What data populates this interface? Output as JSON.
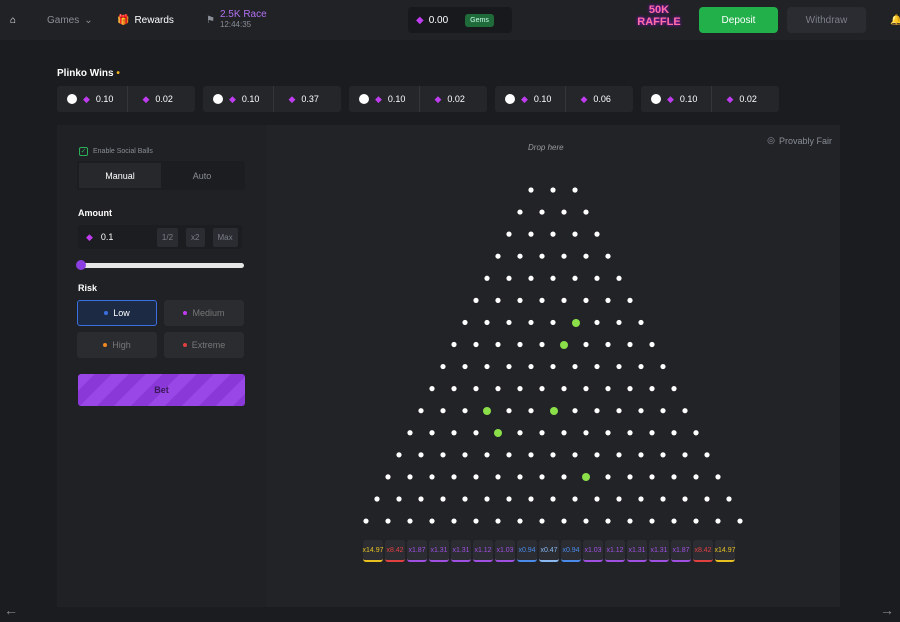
{
  "nav": {
    "games": "Games",
    "rewards": "Rewards",
    "race_title": "2.5K Race",
    "race_timer": "12:44:35",
    "balance": "0.00",
    "currency_badge": "Gems",
    "raffle": "50K RAFFLE",
    "deposit": "Deposit",
    "withdraw": "Withdraw"
  },
  "wins": {
    "title": "Plinko Wins",
    "items": [
      {
        "bet": "0.10",
        "payout": "0.02"
      },
      {
        "bet": "0.10",
        "payout": "0.37"
      },
      {
        "bet": "0.10",
        "payout": "0.02"
      },
      {
        "bet": "0.10",
        "payout": "0.06"
      },
      {
        "bet": "0.10",
        "payout": "0.02"
      }
    ]
  },
  "panel": {
    "social_balls": "Enable Social Balls",
    "social_checked": true,
    "tabs": [
      "Manual",
      "Auto"
    ],
    "active_tab": "Manual",
    "amount_label": "Amount",
    "amount": "0.1",
    "half": "1/2",
    "double": "x2",
    "max": "Max",
    "slider_percent": 0,
    "risk_label": "Risk",
    "risks": [
      {
        "label": "Low",
        "color": "#3b6fe0"
      },
      {
        "label": "Medium",
        "color": "#c03cf0"
      },
      {
        "label": "High",
        "color": "#f08a20"
      },
      {
        "label": "Extreme",
        "color": "#e04040"
      }
    ],
    "active_risk": "Low",
    "bet": "Bet"
  },
  "game": {
    "provably_fair": "Provably Fair",
    "drop_hint": "Drop here",
    "rows": 16,
    "buckets": [
      {
        "v": "x14.97",
        "c": "#e8c020"
      },
      {
        "v": "x8.42",
        "c": "#e04040"
      },
      {
        "v": "x1.87",
        "c": "#a050e0"
      },
      {
        "v": "x1.31",
        "c": "#a050e0"
      },
      {
        "v": "x1.31",
        "c": "#a050e0"
      },
      {
        "v": "x1.12",
        "c": "#a050e0"
      },
      {
        "v": "x1.03",
        "c": "#a050e0"
      },
      {
        "v": "x0.94",
        "c": "#4a8ae8"
      },
      {
        "v": "x0.47",
        "c": "#8ab8f0"
      },
      {
        "v": "x0.94",
        "c": "#4a8ae8"
      },
      {
        "v": "x1.03",
        "c": "#a050e0"
      },
      {
        "v": "x1.12",
        "c": "#a050e0"
      },
      {
        "v": "x1.31",
        "c": "#a050e0"
      },
      {
        "v": "x1.31",
        "c": "#a050e0"
      },
      {
        "v": "x1.87",
        "c": "#a050e0"
      },
      {
        "v": "x8.42",
        "c": "#e04040"
      },
      {
        "v": "x14.97",
        "c": "#e8c020"
      }
    ]
  },
  "colors": {
    "accent": "#8b3fe0",
    "deposit": "#22b04b",
    "gem": "#c03cf0"
  }
}
